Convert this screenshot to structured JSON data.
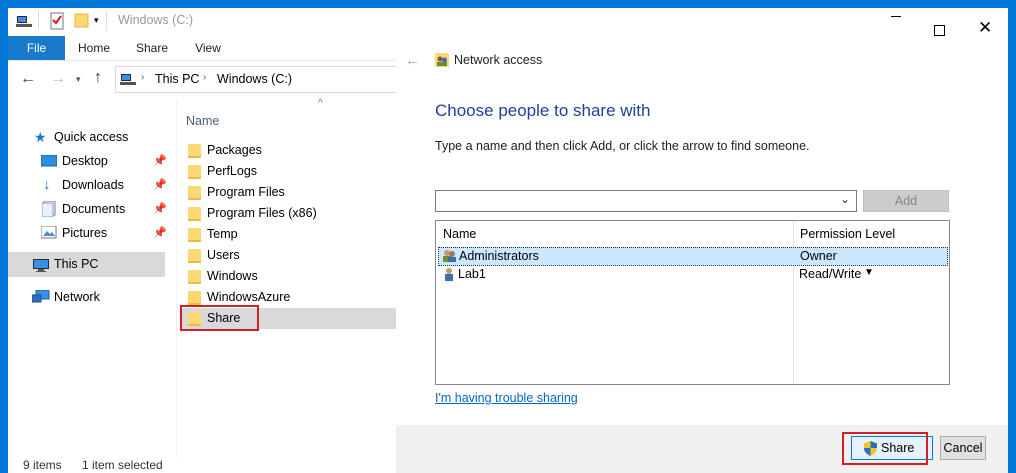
{
  "explorer": {
    "window_title": "Windows (C:)",
    "ribbon_tabs": [
      {
        "label": "File"
      },
      {
        "label": "Home"
      },
      {
        "label": "Share"
      },
      {
        "label": "View"
      }
    ],
    "breadcrumb": [
      "This PC",
      "Windows (C:)"
    ],
    "column_header": "Name",
    "nav": {
      "quick_access": "Quick access",
      "pinned": [
        {
          "label": "Desktop"
        },
        {
          "label": "Downloads"
        },
        {
          "label": "Documents"
        },
        {
          "label": "Pictures"
        }
      ],
      "this_pc": "This PC",
      "network": "Network"
    },
    "files": [
      {
        "name": "Packages"
      },
      {
        "name": "PerfLogs"
      },
      {
        "name": "Program Files"
      },
      {
        "name": "Program Files (x86)"
      },
      {
        "name": "Temp"
      },
      {
        "name": "Users"
      },
      {
        "name": "Windows"
      },
      {
        "name": "WindowsAzure"
      },
      {
        "name": "Share"
      }
    ],
    "status": {
      "item_count": "9 items",
      "selection": "1 item selected"
    }
  },
  "dialog": {
    "title": "Network access",
    "heading": "Choose people to share with",
    "instruction": "Type a name and then click Add, or click the arrow to find someone.",
    "name_input_value": "",
    "add_label": "Add",
    "columns": {
      "name": "Name",
      "permission": "Permission Level"
    },
    "entries": [
      {
        "name": "Administrators",
        "permission": "Owner"
      },
      {
        "name": "Lab1",
        "permission": "Read/Write"
      }
    ],
    "trouble_link": "I'm having trouble sharing",
    "share_label": "Share",
    "cancel_label": "Cancel"
  },
  "colors": {
    "desktop": "#0078d7",
    "accent": "#1979ca",
    "selection": "#cce8ff",
    "highlight_box": "#d11f26",
    "link": "#0066cc"
  }
}
